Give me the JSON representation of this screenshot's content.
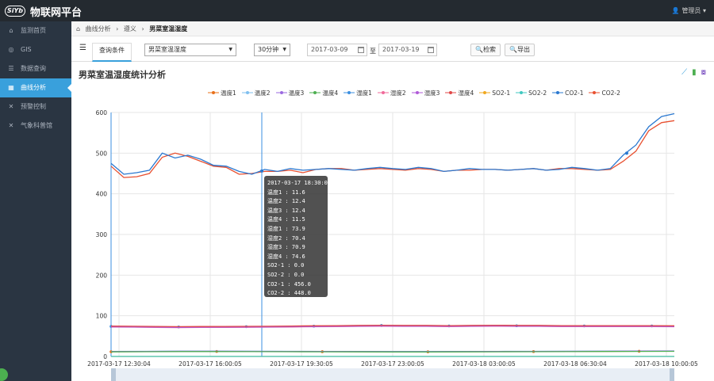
{
  "app": {
    "logo_text": "SiYb",
    "logo_sub": "世纪博",
    "title": "物联网平台",
    "admin": "管理员"
  },
  "sidebar": {
    "items": [
      {
        "label": "监测首页",
        "icon": "home-icon",
        "glyph": "⌂"
      },
      {
        "label": "GIS",
        "icon": "globe-icon",
        "glyph": "◎"
      },
      {
        "label": "数据查询",
        "icon": "search-icon",
        "glyph": "☰"
      },
      {
        "label": "曲线分析",
        "icon": "chart-icon",
        "glyph": "▦",
        "active": true
      },
      {
        "label": "预警控制",
        "icon": "tools-icon",
        "glyph": "✕"
      },
      {
        "label": "气象科普馆",
        "icon": "tools-icon",
        "glyph": "✕"
      }
    ]
  },
  "breadcrumb": {
    "home": "曲线分析",
    "level1": "遵义",
    "current": "男菜室温湿度"
  },
  "toolbar": {
    "query_tab": "查询条件",
    "device": "男菜室温湿度",
    "interval": "30分钟",
    "date_from": "2017-03-09",
    "separator": "至",
    "date_to": "2017-03-19",
    "search_btn": "检索",
    "export_btn": "导出"
  },
  "chart_title": "男菜室温湿度统计分析",
  "chart_data": {
    "type": "line",
    "ylim": [
      0,
      600
    ],
    "yticks": [
      "600",
      "500",
      "400",
      "300",
      "200",
      "100",
      "0"
    ],
    "xticks": [
      "2017-03-17 12:30:04",
      "2017-03-17 16:00:05",
      "2017-03-17 19:30:05",
      "2017-03-17 23:00:05",
      "2017-03-18 03:00:05",
      "2017-03-18 06:30:04",
      "2017-03-18 10:00:05"
    ],
    "series": [
      {
        "name": "温度1",
        "color": "#e8701a"
      },
      {
        "name": "温度2",
        "color": "#7fbfef"
      },
      {
        "name": "温度3",
        "color": "#9b6ae0"
      },
      {
        "name": "温度4",
        "color": "#4caf50"
      },
      {
        "name": "湿度1",
        "color": "#3b8fe0"
      },
      {
        "name": "湿度2",
        "color": "#f06a9a"
      },
      {
        "name": "湿度3",
        "color": "#b05ad8"
      },
      {
        "name": "湿度4",
        "color": "#e04848"
      },
      {
        "name": "SO2-1",
        "color": "#f0a820"
      },
      {
        "name": "SO2-2",
        "color": "#40c8c0"
      },
      {
        "name": "CO2-1",
        "color": "#2a78d0"
      },
      {
        "name": "CO2-2",
        "color": "#e85030"
      }
    ],
    "co2_1": [
      475,
      448,
      452,
      458,
      500,
      488,
      495,
      485,
      470,
      468,
      455,
      448,
      460,
      455,
      462,
      458,
      460,
      462,
      460,
      458,
      462,
      465,
      462,
      460,
      465,
      462,
      455,
      458,
      462,
      460,
      460,
      458,
      460,
      462,
      458,
      460,
      465,
      462,
      458,
      462,
      495,
      520,
      565,
      590,
      597
    ],
    "co2_2": [
      468,
      440,
      442,
      450,
      490,
      500,
      492,
      480,
      468,
      465,
      448,
      450,
      455,
      455,
      458,
      452,
      460,
      462,
      462,
      458,
      460,
      462,
      460,
      458,
      462,
      460,
      455,
      458,
      458,
      460,
      460,
      458,
      460,
      462,
      458,
      462,
      462,
      460,
      458,
      460,
      480,
      505,
      555,
      575,
      580
    ],
    "humidity": [
      73.9,
      73.5,
      73,
      72.5,
      72.8,
      73,
      73.2,
      73.5,
      74,
      74.5,
      75,
      75.5,
      76,
      75.5,
      75.5,
      75,
      75.5,
      76,
      75.5,
      75.5,
      75,
      75,
      75,
      75,
      75,
      74.5
    ],
    "temperature": [
      11.6,
      12,
      12.4,
      12.4,
      12.2,
      12,
      11.8,
      11.6,
      11.5,
      11.5,
      11.6,
      11.8,
      12,
      12.2,
      12.5,
      12.8,
      13
    ],
    "tooltip": [
      "2017-03-17 18:30:03",
      "温度1 : 11.6",
      "温度2 : 12.4",
      "温度3 : 12.4",
      "温度4 : 11.5",
      "湿度1 : 73.9",
      "湿度2 : 70.4",
      "湿度3 : 70.9",
      "湿度4 : 74.6",
      "SO2-1 : 0.0",
      "SO2-2 : 0.0",
      "CO2-1 : 456.0",
      "CO2-2 : 448.0"
    ]
  }
}
